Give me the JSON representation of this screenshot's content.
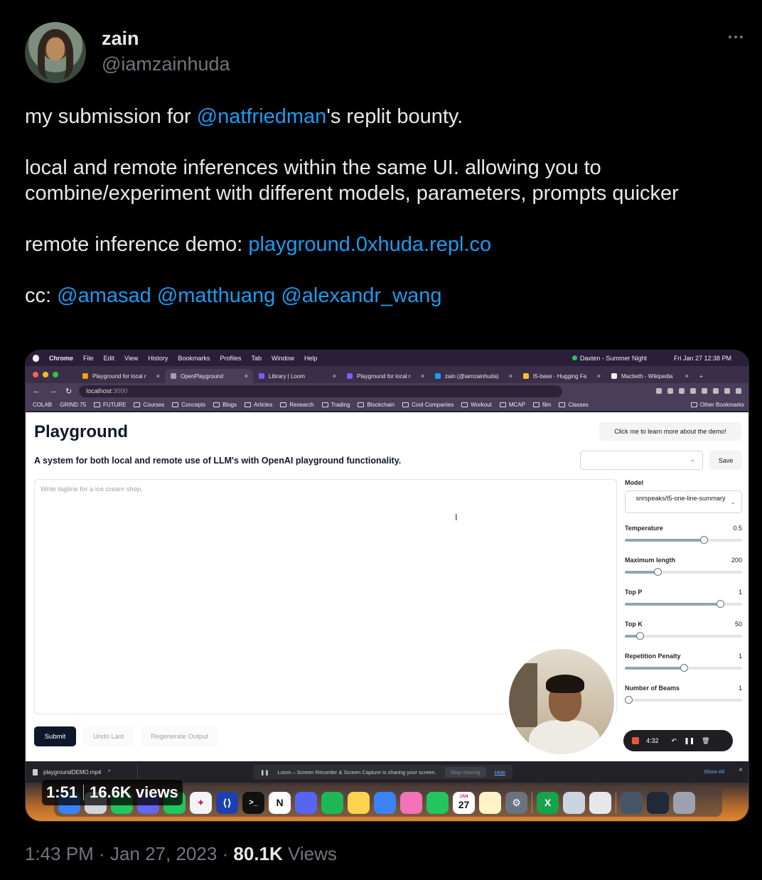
{
  "author": {
    "display_name": "zain",
    "handle": "@iamzainhuda"
  },
  "tweet": {
    "line1_pre": "my submission for ",
    "line1_mention": "@natfriedman",
    "line1_post": "'s replit bounty.",
    "para2": "local and remote inferences within the same UI. allowing you to combine/experiment with different models, parameters, prompts quicker",
    "line3_pre": "remote inference demo:  ",
    "line3_link": "playground.0xhuda.repl.co",
    "cc_label": "cc: ",
    "cc_mentions": [
      "@amasad",
      "@matthuang",
      "@alexandr_wang"
    ]
  },
  "meta": {
    "time": "1:43 PM",
    "date": "Jan 27, 2023",
    "views_count": "80.1K",
    "views_label": "Views"
  },
  "video_badge": {
    "duration": "1:51",
    "views": "16.6K views"
  },
  "mac_menubar": {
    "app": "Chrome",
    "menus": [
      "File",
      "Edit",
      "View",
      "History",
      "Bookmarks",
      "Profiles",
      "Tab",
      "Window",
      "Help"
    ],
    "now_playing": "Daxten - Summer Night",
    "clock": "Fri Jan 27  12:38 PM"
  },
  "browser": {
    "tabs": [
      {
        "label": "Playground for local r",
        "color": "#f59e0b"
      },
      {
        "label": "OpenPlayground",
        "color": "#9ca3af"
      },
      {
        "label": "Library | Loom",
        "color": "#7c5cff"
      },
      {
        "label": "Playground for local r",
        "color": "#7c5cff"
      },
      {
        "label": "zain (@iamzainhuda)",
        "color": "#1d9bf0"
      },
      {
        "label": "t5-base · Hugging Fa",
        "color": "#fbbf24"
      },
      {
        "label": "Macbeth - Wikipedia",
        "color": "#f3f4f6"
      }
    ],
    "url_host": "localhost",
    "url_port": ":3000",
    "bookmarks": [
      "COLAB",
      "GRIND 75",
      "FUTURE",
      "Courses",
      "Concepts",
      "Blogs",
      "Articles",
      "Research",
      "Trading",
      "Blockchain",
      "Cool Companies",
      "Workout",
      "MCAP",
      "film",
      "Classes"
    ],
    "other_bookmarks": "Other Bookmarks"
  },
  "playground": {
    "title": "Playground",
    "subtitle": "A system for both local and remote use of LLM's with OpenAI playground functionality.",
    "learn_button": "Click me to learn more about the demo!",
    "save_button": "Save",
    "prompt_placeholder": "Write tagline for a ice cream shop.",
    "model_label": "Model",
    "model_value": "snrspeaks/t5-one-line-summary",
    "sliders": [
      {
        "label": "Temperature",
        "value": "0.5",
        "fraction": 0.67
      },
      {
        "label": "Maximum length",
        "value": "200",
        "fraction": 0.28
      },
      {
        "label": "Top P",
        "value": "1",
        "fraction": 0.81
      },
      {
        "label": "Top K",
        "value": "50",
        "fraction": 0.13
      },
      {
        "label": "Repetition Penalty",
        "value": "1",
        "fraction": 0.5
      },
      {
        "label": "Number of Beams",
        "value": "1",
        "fraction": 0.03
      }
    ],
    "submit": "Submit",
    "undo": "Undo Last",
    "regenerate": "Regenerate Output"
  },
  "loom": {
    "timer": "4:32",
    "share_note": "Loom – Screen Recorder & Screen Capture is sharing your screen.",
    "stop_sharing": "Stop sharing",
    "hide": "Hide"
  },
  "downloads": {
    "file": "playgroundDEMO.mp4",
    "show_all": "Show All"
  },
  "dock": {
    "calendar_month": "JAN",
    "calendar_day": "27"
  }
}
